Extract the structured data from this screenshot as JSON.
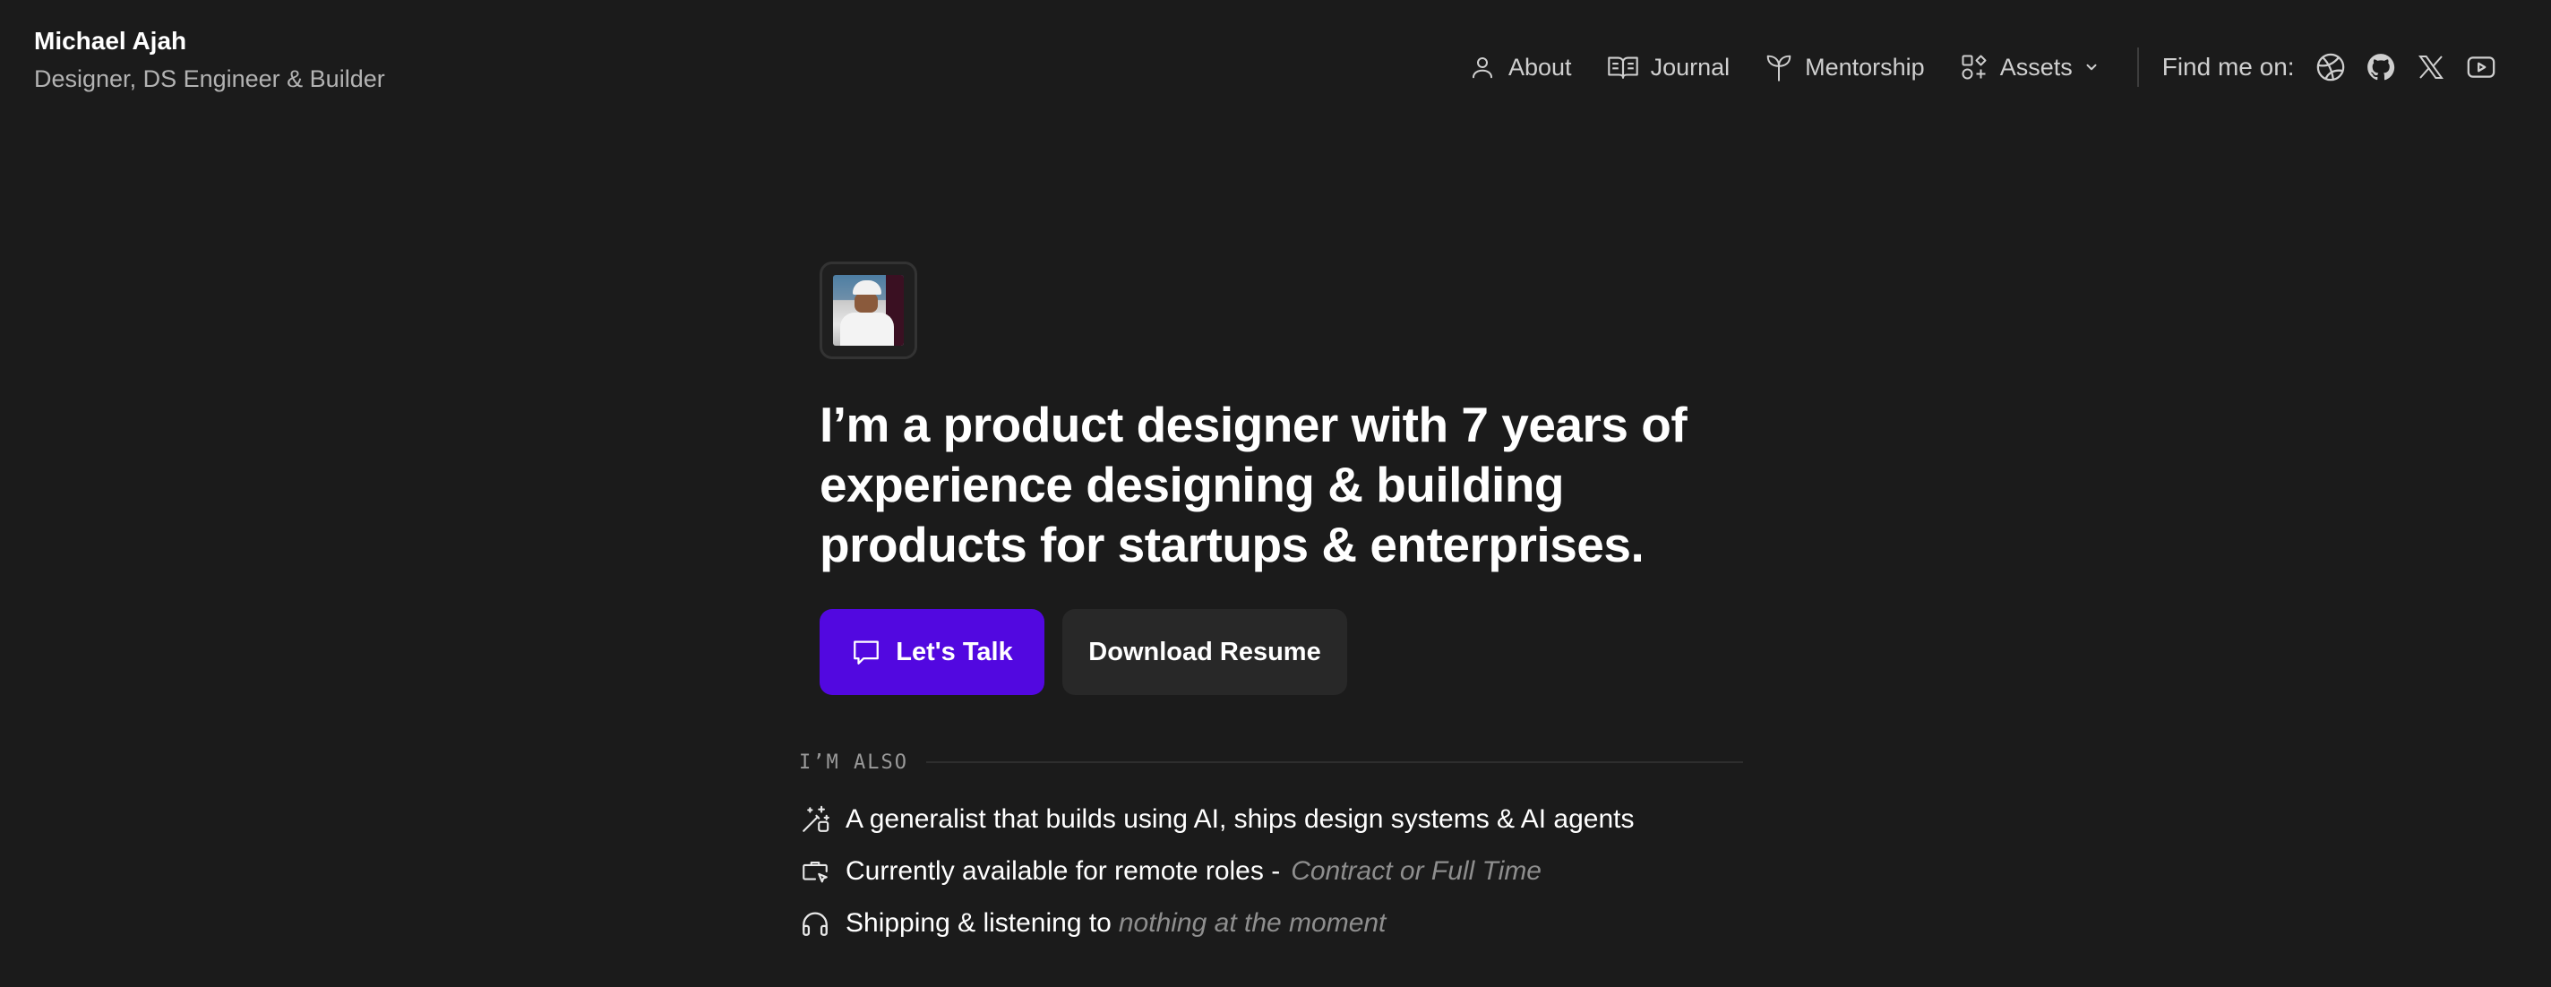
{
  "brand": {
    "name": "Michael Ajah",
    "role": "Designer, DS Engineer & Builder"
  },
  "nav": {
    "items": [
      {
        "label": "About",
        "icon": "user-icon"
      },
      {
        "label": "Journal",
        "icon": "book-open-icon"
      },
      {
        "label": "Mentorship",
        "icon": "sprout-icon"
      },
      {
        "label": "Assets",
        "icon": "shapes-icon"
      }
    ],
    "find_label": "Find me on:",
    "social": [
      "dribbble-icon",
      "github-icon",
      "x-icon",
      "youtube-icon"
    ]
  },
  "hero": {
    "headline": "I’m a product designer with 7 years of experience designing & building products for startups & enterprises.",
    "primary_cta": "Let's Talk",
    "secondary_cta": "Download Resume"
  },
  "also": {
    "title": "I’M ALSO",
    "items": [
      {
        "text": "A generalist that builds using AI, ships design systems & AI agents",
        "muted": "",
        "icon": "sparkle-wand-icon"
      },
      {
        "text": "Currently available for remote roles -",
        "muted": "Contract or Full Time",
        "icon": "briefcase-cursor-icon"
      },
      {
        "text": "Shipping & listening to",
        "muted": "nothing at the moment",
        "icon": "headphones-icon"
      }
    ]
  },
  "colors": {
    "background": "#1b1b1b",
    "primary": "#5208e0",
    "secondary_button": "#282828",
    "muted_text": "#8e8e8e"
  }
}
